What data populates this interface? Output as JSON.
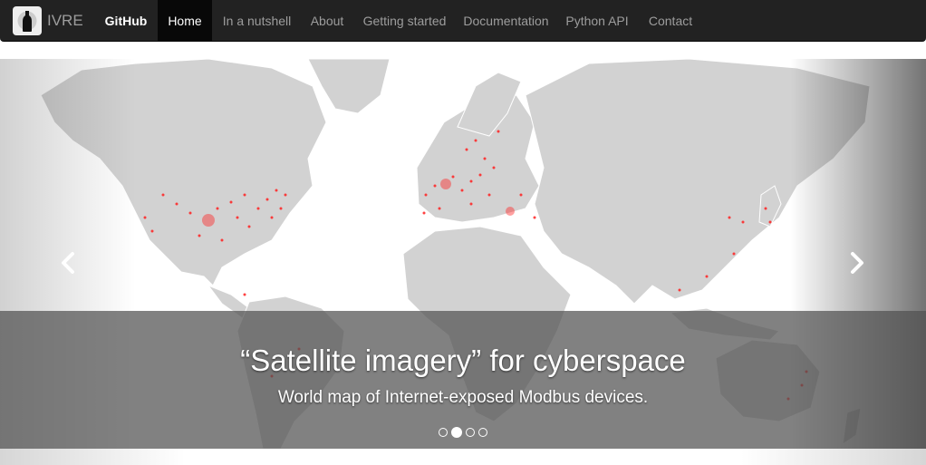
{
  "navbar": {
    "brand": "IVRE",
    "items": [
      {
        "label": "GitHub"
      },
      {
        "label": "Home"
      },
      {
        "label": "In a nutshell"
      },
      {
        "label": "About"
      },
      {
        "label": "Getting started"
      },
      {
        "label": "Documentation"
      },
      {
        "label": "Python API"
      },
      {
        "label": "Contact"
      }
    ],
    "active": "Home"
  },
  "carousel": {
    "title": "“Satellite imagery” for cyberspace",
    "subtitle": "World map of Internet-exposed Modbus devices.",
    "slide_count": 4,
    "active_slide": 2,
    "prev_icon": "chevron-left-icon",
    "next_icon": "chevron-right-icon"
  },
  "colors": {
    "navbar_bg": "#222222",
    "nav_text": "#9d9d9d",
    "active_bg": "#080808",
    "land": "#d2d2d2",
    "device_dots": "#ff2020"
  }
}
